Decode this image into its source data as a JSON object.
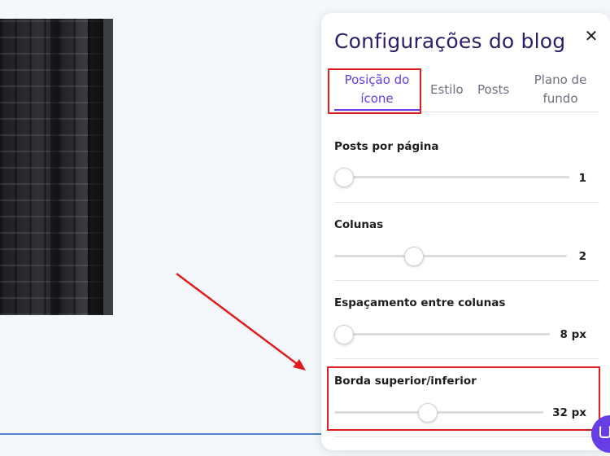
{
  "panel": {
    "title": "Configurações do blog",
    "close_icon": "close-icon"
  },
  "tabs": [
    {
      "label_line1": "Posição do",
      "label_line2": "ícone",
      "active": true
    },
    {
      "label": "Estilo",
      "active": false
    },
    {
      "label": "Posts",
      "active": false
    },
    {
      "label_line1": "Plano de",
      "label_line2": "fundo",
      "active": false
    }
  ],
  "settings": [
    {
      "label": "Posts por página",
      "value": "1",
      "level": 0.0
    },
    {
      "label": "Colunas",
      "value": "2",
      "level": 0.3
    },
    {
      "label": "Espaçamento entre colunas",
      "value": "8 px",
      "level": 0.0
    },
    {
      "label": "Borda superior/inferior",
      "value": "32 px",
      "level": 0.4
    }
  ],
  "colors": {
    "accent": "#673de6",
    "title": "#2f1c6a",
    "annotation": "#e01c1c"
  },
  "icons": {
    "chat": "chat-icon",
    "arrow": "annotation-arrow"
  }
}
